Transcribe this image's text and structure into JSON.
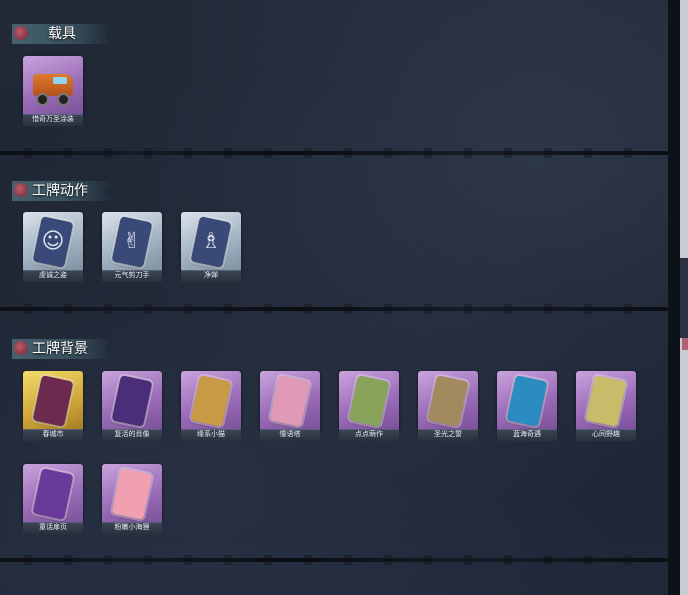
{
  "sections": {
    "vehicle": {
      "title": "载具",
      "items": [
        {
          "label": "惜奇万圣涂装",
          "frame": "purple",
          "art": "vehicle-icon"
        }
      ]
    },
    "badge_action": {
      "title": "工牌动作",
      "items": [
        {
          "label": "虔诚之姿",
          "frame": "silver",
          "art": "silhouette-icon",
          "inner": "#3a4a78",
          "glyph": "☺"
        },
        {
          "label": "元气剪刀手",
          "frame": "silver",
          "art": "silhouette-icon",
          "inner": "#3a4a78",
          "glyph": "✌"
        },
        {
          "label": "净婵",
          "frame": "silver",
          "art": "silhouette-icon",
          "inner": "#3a4a78",
          "glyph": "♗"
        }
      ]
    },
    "badge_background": {
      "title": "工牌背景",
      "items": [
        {
          "label": "春城市",
          "frame": "gold",
          "art": "card-art-icon",
          "inner": "#6b2a4e"
        },
        {
          "label": "复活的肖像",
          "frame": "purple",
          "art": "card-art-icon",
          "inner": "#4a2e7a"
        },
        {
          "label": "缘系小猫",
          "frame": "purple",
          "art": "card-art-icon",
          "inner": "#c99a46"
        },
        {
          "label": "憧语塔",
          "frame": "purple",
          "art": "card-art-icon",
          "inner": "#e09ab8"
        },
        {
          "label": "点点萌作",
          "frame": "purple",
          "art": "card-art-icon",
          "inner": "#8aa35a"
        },
        {
          "label": "圣光之誓",
          "frame": "purple",
          "art": "card-art-icon",
          "inner": "#a28a5e"
        },
        {
          "label": "蓝海奇遇",
          "frame": "purple",
          "art": "card-art-icon",
          "inner": "#2a8cc0"
        },
        {
          "label": "心间野趣",
          "frame": "purple",
          "art": "card-art-icon",
          "inner": "#c8bc6a"
        },
        {
          "label": "童话扉页",
          "frame": "purple",
          "art": "card-art-icon",
          "inner": "#6a3a9a"
        },
        {
          "label": "粉嫩小海狸",
          "frame": "purple",
          "art": "card-art-icon",
          "inner": "#f0a0b0"
        }
      ]
    }
  },
  "colors": {
    "background": "#1b2230",
    "header_banner": "#4d6b78",
    "label_text": "#e8ecf2"
  }
}
